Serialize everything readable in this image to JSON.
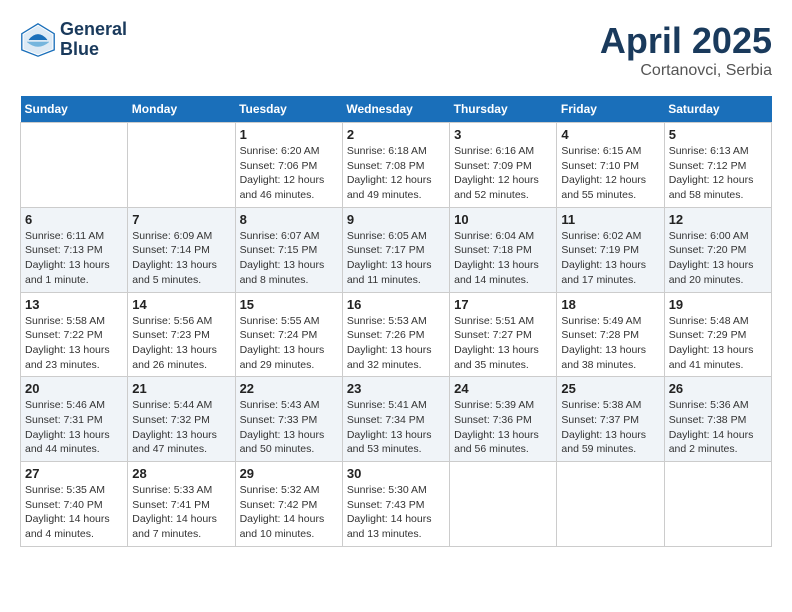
{
  "header": {
    "logo_line1": "General",
    "logo_line2": "Blue",
    "month_title": "April 2025",
    "location": "Cortanovci, Serbia"
  },
  "days_of_week": [
    "Sunday",
    "Monday",
    "Tuesday",
    "Wednesday",
    "Thursday",
    "Friday",
    "Saturday"
  ],
  "weeks": [
    [
      {
        "num": "",
        "info": ""
      },
      {
        "num": "",
        "info": ""
      },
      {
        "num": "1",
        "info": "Sunrise: 6:20 AM\nSunset: 7:06 PM\nDaylight: 12 hours\nand 46 minutes."
      },
      {
        "num": "2",
        "info": "Sunrise: 6:18 AM\nSunset: 7:08 PM\nDaylight: 12 hours\nand 49 minutes."
      },
      {
        "num": "3",
        "info": "Sunrise: 6:16 AM\nSunset: 7:09 PM\nDaylight: 12 hours\nand 52 minutes."
      },
      {
        "num": "4",
        "info": "Sunrise: 6:15 AM\nSunset: 7:10 PM\nDaylight: 12 hours\nand 55 minutes."
      },
      {
        "num": "5",
        "info": "Sunrise: 6:13 AM\nSunset: 7:12 PM\nDaylight: 12 hours\nand 58 minutes."
      }
    ],
    [
      {
        "num": "6",
        "info": "Sunrise: 6:11 AM\nSunset: 7:13 PM\nDaylight: 13 hours\nand 1 minute."
      },
      {
        "num": "7",
        "info": "Sunrise: 6:09 AM\nSunset: 7:14 PM\nDaylight: 13 hours\nand 5 minutes."
      },
      {
        "num": "8",
        "info": "Sunrise: 6:07 AM\nSunset: 7:15 PM\nDaylight: 13 hours\nand 8 minutes."
      },
      {
        "num": "9",
        "info": "Sunrise: 6:05 AM\nSunset: 7:17 PM\nDaylight: 13 hours\nand 11 minutes."
      },
      {
        "num": "10",
        "info": "Sunrise: 6:04 AM\nSunset: 7:18 PM\nDaylight: 13 hours\nand 14 minutes."
      },
      {
        "num": "11",
        "info": "Sunrise: 6:02 AM\nSunset: 7:19 PM\nDaylight: 13 hours\nand 17 minutes."
      },
      {
        "num": "12",
        "info": "Sunrise: 6:00 AM\nSunset: 7:20 PM\nDaylight: 13 hours\nand 20 minutes."
      }
    ],
    [
      {
        "num": "13",
        "info": "Sunrise: 5:58 AM\nSunset: 7:22 PM\nDaylight: 13 hours\nand 23 minutes."
      },
      {
        "num": "14",
        "info": "Sunrise: 5:56 AM\nSunset: 7:23 PM\nDaylight: 13 hours\nand 26 minutes."
      },
      {
        "num": "15",
        "info": "Sunrise: 5:55 AM\nSunset: 7:24 PM\nDaylight: 13 hours\nand 29 minutes."
      },
      {
        "num": "16",
        "info": "Sunrise: 5:53 AM\nSunset: 7:26 PM\nDaylight: 13 hours\nand 32 minutes."
      },
      {
        "num": "17",
        "info": "Sunrise: 5:51 AM\nSunset: 7:27 PM\nDaylight: 13 hours\nand 35 minutes."
      },
      {
        "num": "18",
        "info": "Sunrise: 5:49 AM\nSunset: 7:28 PM\nDaylight: 13 hours\nand 38 minutes."
      },
      {
        "num": "19",
        "info": "Sunrise: 5:48 AM\nSunset: 7:29 PM\nDaylight: 13 hours\nand 41 minutes."
      }
    ],
    [
      {
        "num": "20",
        "info": "Sunrise: 5:46 AM\nSunset: 7:31 PM\nDaylight: 13 hours\nand 44 minutes."
      },
      {
        "num": "21",
        "info": "Sunrise: 5:44 AM\nSunset: 7:32 PM\nDaylight: 13 hours\nand 47 minutes."
      },
      {
        "num": "22",
        "info": "Sunrise: 5:43 AM\nSunset: 7:33 PM\nDaylight: 13 hours\nand 50 minutes."
      },
      {
        "num": "23",
        "info": "Sunrise: 5:41 AM\nSunset: 7:34 PM\nDaylight: 13 hours\nand 53 minutes."
      },
      {
        "num": "24",
        "info": "Sunrise: 5:39 AM\nSunset: 7:36 PM\nDaylight: 13 hours\nand 56 minutes."
      },
      {
        "num": "25",
        "info": "Sunrise: 5:38 AM\nSunset: 7:37 PM\nDaylight: 13 hours\nand 59 minutes."
      },
      {
        "num": "26",
        "info": "Sunrise: 5:36 AM\nSunset: 7:38 PM\nDaylight: 14 hours\nand 2 minutes."
      }
    ],
    [
      {
        "num": "27",
        "info": "Sunrise: 5:35 AM\nSunset: 7:40 PM\nDaylight: 14 hours\nand 4 minutes."
      },
      {
        "num": "28",
        "info": "Sunrise: 5:33 AM\nSunset: 7:41 PM\nDaylight: 14 hours\nand 7 minutes."
      },
      {
        "num": "29",
        "info": "Sunrise: 5:32 AM\nSunset: 7:42 PM\nDaylight: 14 hours\nand 10 minutes."
      },
      {
        "num": "30",
        "info": "Sunrise: 5:30 AM\nSunset: 7:43 PM\nDaylight: 14 hours\nand 13 minutes."
      },
      {
        "num": "",
        "info": ""
      },
      {
        "num": "",
        "info": ""
      },
      {
        "num": "",
        "info": ""
      }
    ]
  ]
}
